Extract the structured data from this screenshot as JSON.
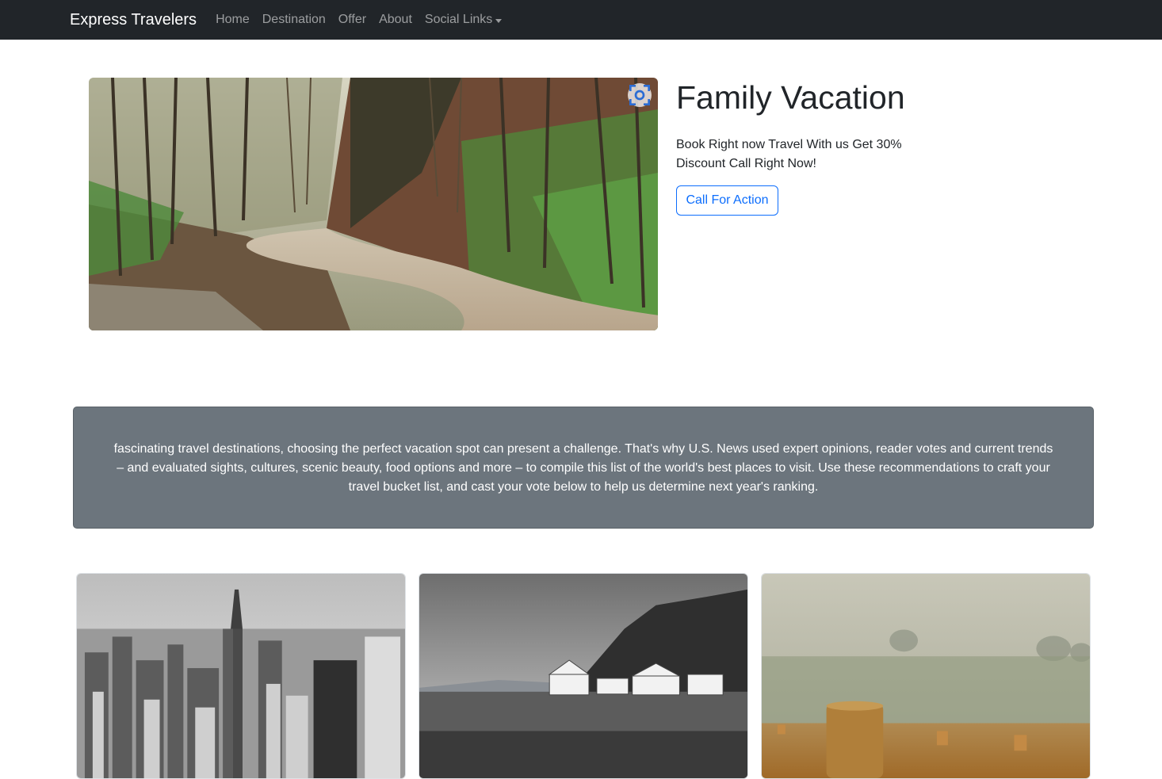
{
  "navbar": {
    "brand": "Express Travelers",
    "links": [
      "Home",
      "Destination",
      "Offer",
      "About"
    ],
    "dropdown_label": "Social Links"
  },
  "hero": {
    "title": "Family Vacation",
    "text": "Book Right now Travel With us Get 30% Discount Call Right Now!",
    "button_label": "Call For Action"
  },
  "info": {
    "text": "fascinating travel destinations, choosing the perfect vacation spot can present a challenge. That's why U.S. News used expert opinions, reader votes and current trends – and evaluated sights, cultures, scenic beauty, food options and more – to compile this list of the world's best places to visit. Use these recommendations to craft your travel bucket list, and cast your vote below to help us determine next year's ranking."
  },
  "colors": {
    "navbar_bg": "#212529",
    "primary": "#0d6efd",
    "panel_bg": "#6c757d"
  },
  "icons": {
    "lens": "visual-search-icon",
    "caret": "caret-down-icon"
  }
}
